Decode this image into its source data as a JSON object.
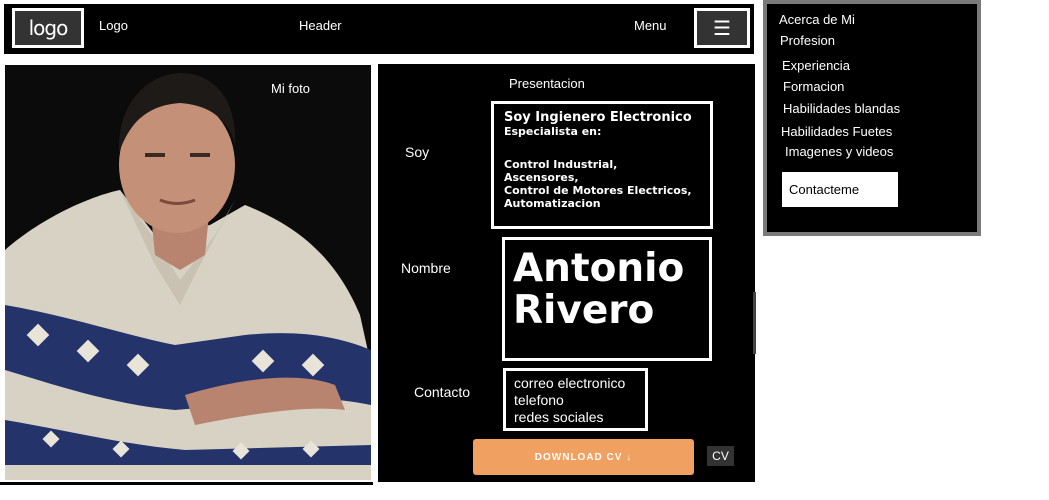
{
  "header": {
    "logo_mark": "logo",
    "logo_label": "Logo",
    "title": "Header",
    "menu_label": "Menu",
    "menu_icon": "hamburger-icon"
  },
  "menu": {
    "items": [
      "Acerca de Mi",
      "Profesion",
      "Experiencia",
      "Formacion",
      "Habilidades blandas",
      "Habilidades Fuetes",
      "Imagenes y videos"
    ],
    "contact_button": "Contacteme"
  },
  "photo": {
    "label": "Mi foto"
  },
  "presentation": {
    "title": "Presentacion",
    "soy_label": "Soy",
    "soy_title": "Soy Ingienero Electronico",
    "soy_subtitle": "Especialista en:",
    "specialties": [
      "Control Industrial,",
      "Ascensores,",
      "Control de Motores Electricos,",
      "Automatizacion"
    ],
    "name_label": "Nombre",
    "first_name": "Antonio",
    "last_name": "Rivero",
    "contact_label": "Contacto",
    "contact_items": [
      "correo electronico",
      "telefono",
      "redes sociales"
    ],
    "download_button": "DOWNLOAD CV ↓",
    "cv_label": "CV"
  },
  "colors": {
    "panel_bg": "#000000",
    "download_accent": "#f0a060",
    "dropdown_border": "#7a7a7a"
  }
}
